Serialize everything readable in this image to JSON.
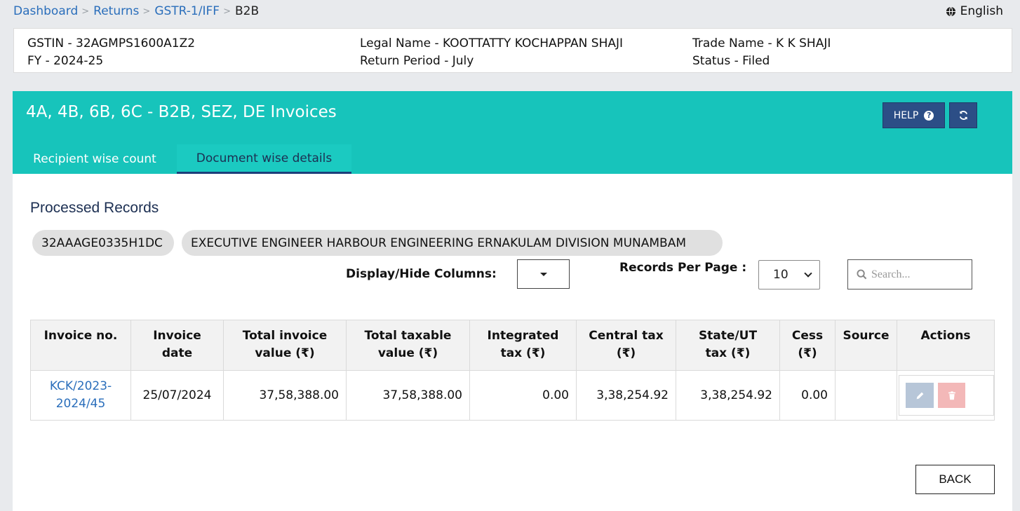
{
  "breadcrumb": [
    "Dashboard",
    "Returns",
    "GSTR-1/IFF",
    "B2B"
  ],
  "language": {
    "icon": "globe-icon",
    "label": "English"
  },
  "taxpayer": {
    "gstin": "GSTIN - 32AGMPS1600A1Z2",
    "fy": "FY - 2024-25",
    "legal_name": "Legal Name - KOOTTATTY KOCHAPPAN SHAJI",
    "return_period": "Return Period - July",
    "trade_name": "Trade Name - K K SHAJI",
    "status": "Status - Filed"
  },
  "panel": {
    "title": "4A, 4B, 6B, 6C - B2B, SEZ, DE Invoices",
    "help_label": "HELP",
    "help_icon": "question-circle-icon",
    "refresh_icon": "refresh-icon",
    "tabs": [
      {
        "label": "Recipient wise count",
        "active": false
      },
      {
        "label": "Document wise details",
        "active": true
      }
    ]
  },
  "records": {
    "title": "Processed Records",
    "recipient_gstin": "32AAAGE0335H1DC",
    "recipient_name": "EXECUTIVE ENGINEER HARBOUR ENGINEERING ERNAKULAM DIVISION MUNAMBAM",
    "display_hide_label": "Display/Hide Columns:",
    "records_per_page_label": "Records Per Page :",
    "records_per_page_value": "10",
    "search_placeholder": "Search..."
  },
  "table": {
    "headers": {
      "invoice_no": "Invoice no.",
      "invoice_date": "Invoice date",
      "total_invoice": "Total invoice value (₹)",
      "total_taxable": "Total taxable value (₹)",
      "integrated": "Integrated tax (₹)",
      "central": "Central tax (₹)",
      "state": "State/UT tax (₹)",
      "cess": "Cess (₹)",
      "source": "Source",
      "actions": "Actions"
    },
    "rows": [
      {
        "invoice_no": "KCK/2023-2024/45",
        "invoice_date": "25/07/2024",
        "total_invoice": "37,58,388.00",
        "total_taxable": "37,58,388.00",
        "integrated": "0.00",
        "central": "3,38,254.92",
        "state": "3,38,254.92",
        "cess": "0.00",
        "source": ""
      }
    ]
  },
  "back_label": "BACK"
}
